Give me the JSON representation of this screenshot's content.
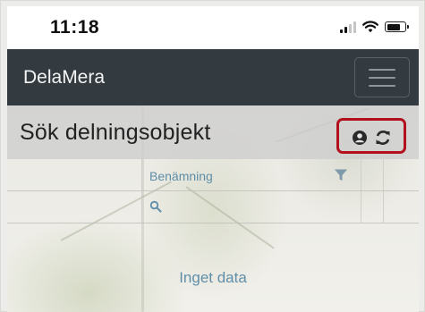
{
  "statusbar": {
    "time": "11:18"
  },
  "navbar": {
    "brand": "DelaMera"
  },
  "page": {
    "title": "Sök delningsobjekt"
  },
  "grid": {
    "columns": [
      {
        "label": "",
        "filter_value": ""
      },
      {
        "label": "Benämning",
        "filter_value": ""
      },
      {
        "label": "",
        "filter_value": ""
      },
      {
        "label": "",
        "filter_value": ""
      }
    ],
    "empty_message": "Inget data"
  },
  "colors": {
    "navbar": "#333a40",
    "highlight_border": "#b3101e",
    "column_text": "#5f8ea9"
  },
  "icons": [
    "signal-icon",
    "wifi-icon",
    "battery-icon",
    "menu-icon",
    "user-icon",
    "refresh-icon",
    "filter-icon",
    "search-icon"
  ]
}
